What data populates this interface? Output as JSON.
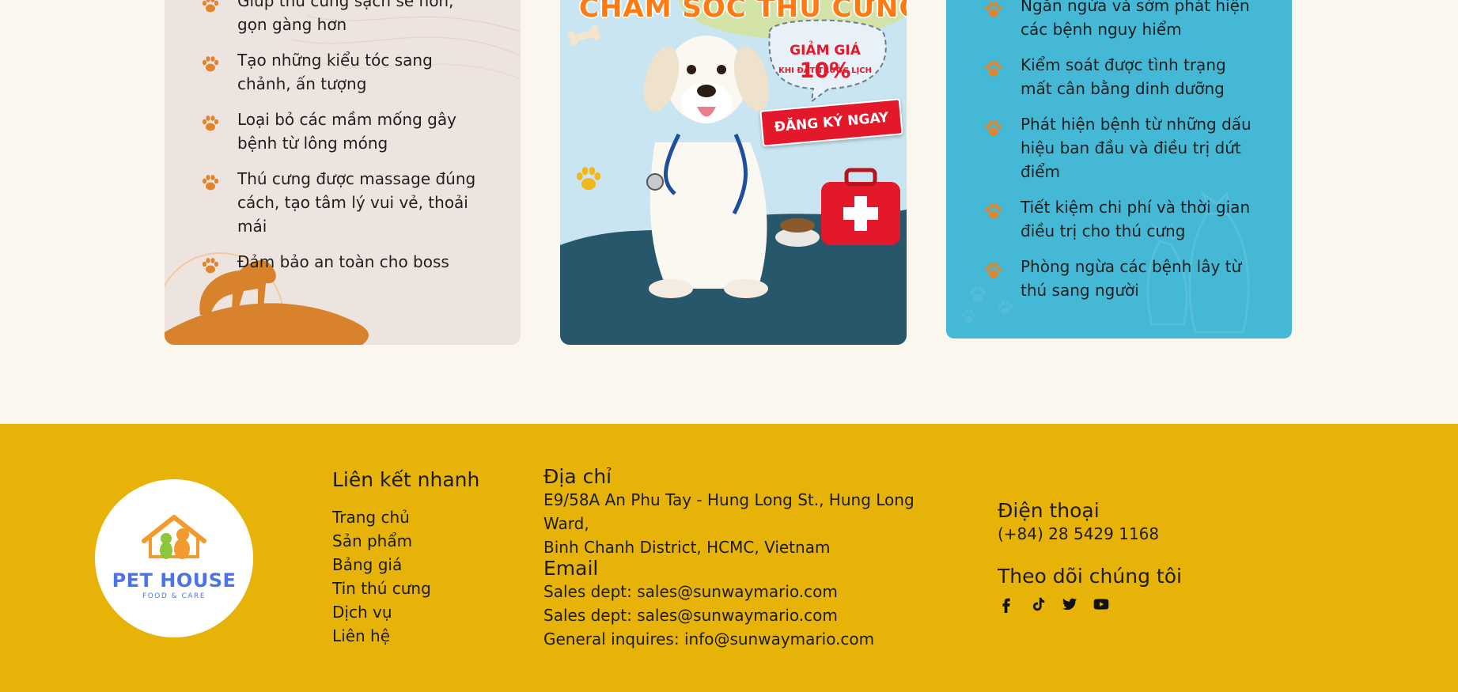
{
  "left_card": {
    "items": [
      "Giúp thú cưng sạch sẽ hơn, gọn gàng hơn",
      "Tạo những kiểu tóc sang chảnh, ấn tượng",
      "Loại bỏ các mầm mống gây bệnh từ lông móng",
      "Thú cưng được massage đúng cách, tạo tâm lý vui vẻ, thoải mái",
      "Đảm bảo an toàn cho boss"
    ]
  },
  "poster": {
    "title": "CHĂM SÓC THÚ CƯNG",
    "discount_prefix": "GIẢM GIÁ",
    "discount_value": "10%",
    "discount_note": "KHI ĐẶT TRƯỚC LỊCH",
    "register_label": "ĐĂNG KÝ NGAY"
  },
  "right_card": {
    "items": [
      "Ngăn ngừa và sớm phát hiện các bệnh nguy hiểm",
      "Kiểm soát được tình trạng mất cân bằng dinh dưỡng",
      "Phát hiện bệnh từ những dấu hiệu ban đầu và điều trị dứt điểm",
      "Tiết kiệm chi phí và thời gian điều trị cho thú cưng",
      "Phòng ngừa các bệnh lây từ thú sang người"
    ]
  },
  "footer": {
    "logo": {
      "name": "PET HOUSE",
      "tagline": "FOOD & CARE"
    },
    "quick_links": {
      "heading": "Liên kết nhanh",
      "links": [
        "Trang chủ",
        "Sản phẩm",
        "Bảng giá",
        "Tin thú cưng",
        "Dịch vụ",
        "Liên hệ"
      ]
    },
    "address": {
      "heading": "Địa chỉ",
      "lines": [
        "E9/58A An Phu Tay - Hung Long St., Hung Long Ward,",
        "Binh Chanh District, HCMC, Vietnam"
      ]
    },
    "email": {
      "heading": "Email",
      "lines": [
        "Sales dept: sales@sunwaymario.com",
        "Sales dept: sales@sunwaymario.com",
        "General inquires: info@sunwaymario.com"
      ]
    },
    "phone": {
      "heading": "Điện thoại",
      "value": "(+84) 28 5429 1168"
    },
    "follow": {
      "heading": "Theo dõi chúng tôi",
      "icons": [
        "facebook-icon",
        "tiktok-icon",
        "twitter-icon",
        "youtube-icon"
      ]
    }
  },
  "colors": {
    "page_bg": "#fbf6ee",
    "left_card_bg": "#ede4e0",
    "right_card_bg": "#45b8d6",
    "footer_bg": "#e8b308",
    "paw_accent": "#e0852c",
    "brand_blue": "#4d73e9",
    "cta_red": "#e3192b"
  }
}
